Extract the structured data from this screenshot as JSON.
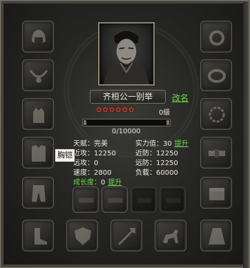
{
  "character": {
    "name": "齐桓公一别举",
    "rename_label": "改名",
    "stars": 6,
    "level_text": "0级",
    "exp_text": "0/10000",
    "exp_fraction": 0
  },
  "stats": {
    "talent": {
      "label": "天赋：",
      "value": "完美"
    },
    "strength": {
      "label": "实力值：",
      "value": "30",
      "action": "提升"
    },
    "melee_attack": {
      "label": "近攻：",
      "value": "12250"
    },
    "melee_defense": {
      "label": "近防：",
      "value": "12250"
    },
    "ranged_attack": {
      "label": "远攻：",
      "value": "0"
    },
    "ranged_defense": {
      "label": "远防：",
      "value": "12250"
    },
    "speed": {
      "label": "速度：",
      "value": "2800"
    },
    "load": {
      "label": "负载：",
      "value": "60000"
    },
    "growth": {
      "label": "成长度：",
      "value": "0",
      "action": "提升"
    }
  },
  "tooltip": "胸铠",
  "colors": {
    "accent_green": "#6fdc4a",
    "star_red": "#cf3a2c",
    "frame": "#6d6a60"
  },
  "slots": {
    "left": [
      "helmet-icon",
      "necklace-icon",
      "glove-icon",
      "chest-armor-icon",
      "pants-icon"
    ],
    "right": [
      "ring-icon",
      "bracelet-icon",
      "amulet-icon",
      "belt-icon",
      "chest-icon"
    ],
    "bottom": [
      "boots-icon",
      "shield-icon",
      "spear-icon",
      "horse-icon",
      "cloak-icon"
    ],
    "middle": [
      "gem-slot-1",
      "gem-slot-2",
      "gem-slot-3",
      "gem-slot-4"
    ]
  }
}
